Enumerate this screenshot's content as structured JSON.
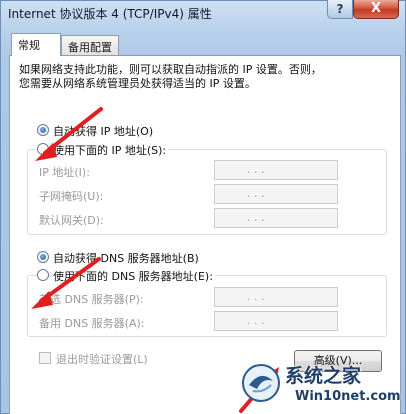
{
  "window": {
    "title": "Internet 协议版本 4 (TCP/IPv4) 属性",
    "help_label": "?",
    "close_label": "X"
  },
  "tabs": [
    {
      "label": "常规",
      "active": true
    },
    {
      "label": "备用配置",
      "active": false
    }
  ],
  "general": {
    "description_line1": "如果网络支持此功能，则可以获取自动指派的 IP 设置。否则，",
    "description_line2": "您需要从网络系统管理员处获得适当的 IP 设置。",
    "ip_auto_label": "自动获得 IP 地址(O)",
    "ip_manual_label": "使用下面的 IP 地址(S):",
    "ip_auto_selected": true,
    "ip_fields": [
      {
        "label": "IP 地址(I):",
        "value": ". . ."
      },
      {
        "label": "子网掩码(U):",
        "value": ". . ."
      },
      {
        "label": "默认网关(D):",
        "value": ". . ."
      }
    ],
    "dns_auto_label": "自动获得 DNS 服务器地址(B)",
    "dns_manual_label": "使用下面的 DNS 服务器地址(E):",
    "dns_auto_selected": true,
    "dns_fields": [
      {
        "label": "首选 DNS 服务器(P):",
        "value": ". . ."
      },
      {
        "label": "备用 DNS 服务器(A):",
        "value": ". . ."
      }
    ],
    "validate_on_exit_label": "退出时验证设置(L)",
    "validate_on_exit_checked": false,
    "advanced_button_label": "高级(V)..."
  },
  "watermark": {
    "brand": "系统之家",
    "url": "Win10net.com"
  },
  "colors": {
    "annotation_arrow": "#e02020",
    "titlebar": "#b9d1ea",
    "close_button": "#c94a33"
  }
}
